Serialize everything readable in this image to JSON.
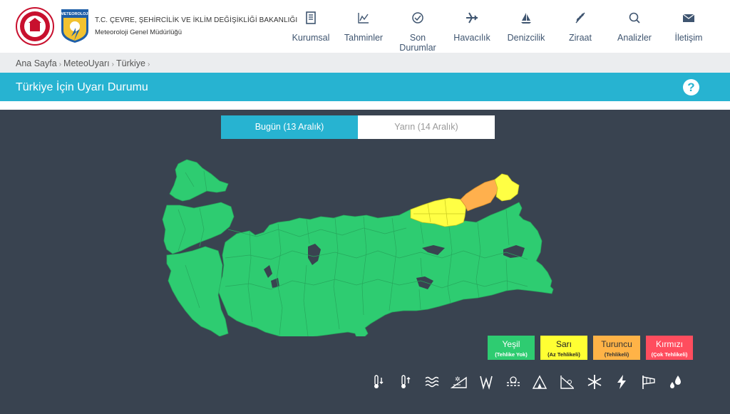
{
  "header": {
    "org_title": "T.C. ÇEVRE, ŞEHİRCİLİK VE İKLİM DEĞİŞİKLİĞİ BAKANLIĞI",
    "org_subtitle": "Meteoroloji Genel Müdürlüğü",
    "logo_text": "METEOROLOJİ",
    "nav": [
      {
        "label": "Kurumsal",
        "icon": "document-icon"
      },
      {
        "label": "Tahminler",
        "icon": "chart-icon"
      },
      {
        "label": "Son Durumlar",
        "icon": "check-circle-icon"
      },
      {
        "label": "Havacılık",
        "icon": "airplane-icon"
      },
      {
        "label": "Denizcilik",
        "icon": "sailboat-icon"
      },
      {
        "label": "Ziraat",
        "icon": "wheat-icon"
      },
      {
        "label": "Analizler",
        "icon": "search-analysis-icon"
      },
      {
        "label": "İletişim",
        "icon": "envelope-icon"
      }
    ]
  },
  "breadcrumb": [
    "Ana Sayfa",
    "MeteoUyarı",
    "Türkiye"
  ],
  "page_title": "Türkiye İçin Uyarı Durumu",
  "help_label": "?",
  "tabs": [
    {
      "label": "Bugün (13 Aralık)",
      "active": true
    },
    {
      "label": "Yarın (14 Aralık)",
      "active": false
    }
  ],
  "legend": [
    {
      "label": "Yeşil",
      "sub": "(Tehlike Yok)",
      "color": "#2ecc71",
      "text": "#ffffff"
    },
    {
      "label": "Sarı",
      "sub": "(Az Tehlikeli)",
      "color": "#ffff33",
      "text": "#222222"
    },
    {
      "label": "Turuncu",
      "sub": "(Tehlikeli)",
      "color": "#ffb347",
      "text": "#333333"
    },
    {
      "label": "Kırmızı",
      "sub": "(Çok Tehlikeli)",
      "color": "#ff4d5e",
      "text": "#ffffff"
    }
  ],
  "map_colors": {
    "green": "#2ecc71",
    "yellow": "#ffff44",
    "orange": "#ffb04d",
    "lake": "#394350"
  },
  "hazard_icons": [
    "cold-temperature-icon",
    "hot-temperature-icon",
    "wind-waves-icon",
    "snow-avalanche-icon",
    "strong-wind-icon",
    "fog-icon",
    "mountain-avalanche-icon",
    "landslide-icon",
    "snowflake-icon",
    "lightning-icon",
    "windsock-icon",
    "rain-drops-icon"
  ],
  "colors": {
    "accent": "#27b3d1",
    "background": "#394350",
    "nav_text": "#3f5570"
  }
}
